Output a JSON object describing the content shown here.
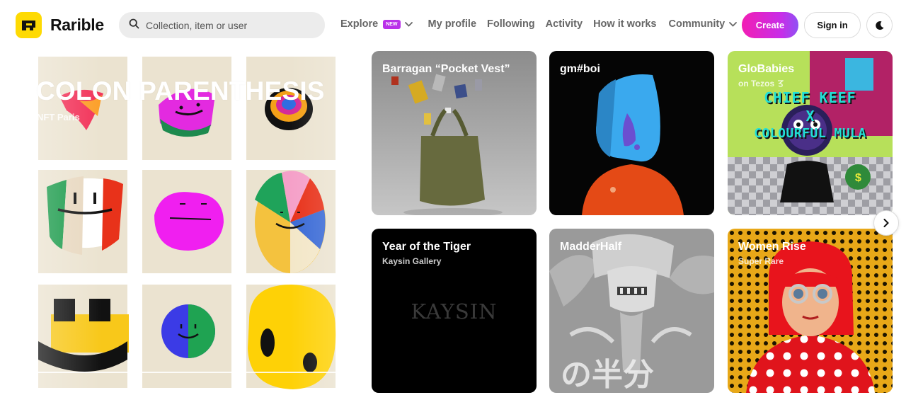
{
  "brand": {
    "name": "Rarible",
    "accent": "#FEDA03"
  },
  "search": {
    "placeholder": "Collection, item or user"
  },
  "nav": {
    "explore": "Explore",
    "explore_badge": "NEW",
    "my_profile": "My profile",
    "following": "Following",
    "activity": "Activity",
    "how_it_works": "How it works",
    "community": "Community"
  },
  "actions": {
    "create": "Create",
    "sign_in": "Sign in"
  },
  "hero": {
    "title": "COLON PARENTHESIS",
    "subtitle": "NFT Paris"
  },
  "cards": [
    {
      "title": "Barragan “Pocket Vest”",
      "subtitle": ""
    },
    {
      "title": "gm#boi",
      "subtitle": ""
    },
    {
      "title": "GloBabies",
      "subtitle": "on Tezos"
    },
    {
      "title": "Year of the Tiger",
      "subtitle": "Kaysin Gallery",
      "art_text": "KAYSIN"
    },
    {
      "title": "MadderHalf",
      "subtitle": ""
    },
    {
      "title": "Women Rise",
      "subtitle": "Super Rare"
    }
  ],
  "globabies_art": {
    "line1": "CHIEF KEEF",
    "line2": "X",
    "line3": "COLOURFUL MULA"
  },
  "madderhalf_art": {
    "text": "の半分"
  },
  "icons": {
    "search": "search-icon",
    "chevron": "chevron-down-icon",
    "theme": "moon-icon",
    "next": "chevron-right-icon"
  },
  "colors": {
    "create_gradient_start": "#f21eb4",
    "create_gradient_end": "#8f51f4",
    "badge_new": "#b931e9"
  }
}
